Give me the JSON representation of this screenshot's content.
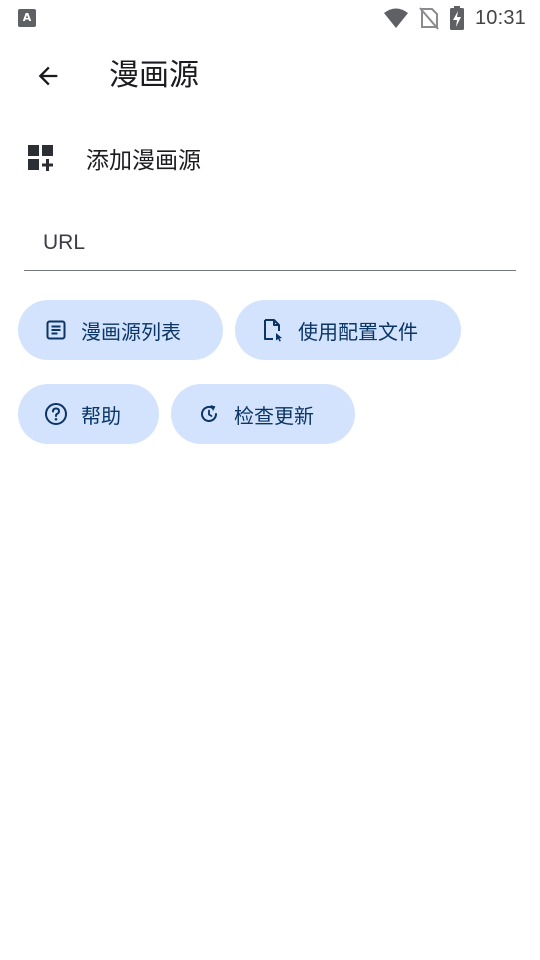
{
  "status_bar": {
    "left_indicator": "A",
    "time": "10:31"
  },
  "top_bar": {
    "title": "漫画源"
  },
  "section": {
    "title": "添加漫画源"
  },
  "url_field": {
    "placeholder": "URL",
    "value": ""
  },
  "actions": {
    "source_list": "漫画源列表",
    "use_config": "使用配置文件",
    "help": "帮助",
    "check_update": "检查更新"
  },
  "colors": {
    "chip_background": "#d3e3fd",
    "chip_content": "#0a3566",
    "text_primary": "#1b1b1f"
  },
  "icons": {
    "back": "arrow-back-icon",
    "section": "widgets-add-icon",
    "source_list": "list-document-icon",
    "use_config": "file-config-icon",
    "help": "help-circle-icon",
    "check_update": "refresh-icon"
  }
}
